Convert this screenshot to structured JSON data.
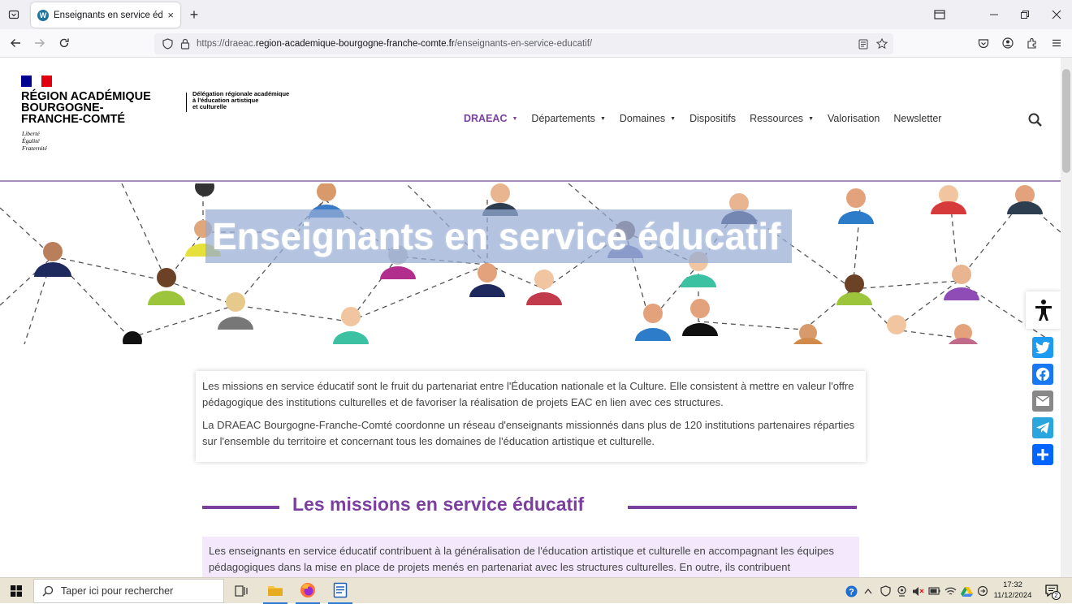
{
  "browser": {
    "tab_title": "Enseignants en service éducatif",
    "tab_close": "×",
    "new_tab": "+",
    "url_prefix": "https://draeac.",
    "url_domain": "region-academique-bourgogne-franche-comte.fr",
    "url_path": "/enseignants-en-service-educatif/"
  },
  "site": {
    "org_line1": "RÉGION ACADÉMIQUE",
    "org_line2": "BOURGOGNE-",
    "org_line3": "FRANCHE-COMTÉ",
    "motto1": "Liberté",
    "motto2": "Égalité",
    "motto3": "Fraternité",
    "dept_line1": "Délégation régionale académique",
    "dept_line2": "à l'éducation artistique",
    "dept_line3": "et culturelle"
  },
  "menu": {
    "items": [
      {
        "label": "DRAEAC",
        "caret": "▼"
      },
      {
        "label": "Départements",
        "caret": "▼"
      },
      {
        "label": "Domaines",
        "caret": "▼"
      },
      {
        "label": "Dispositifs",
        "caret": ""
      },
      {
        "label": "Ressources",
        "caret": "▼"
      },
      {
        "label": "Valorisation",
        "caret": ""
      },
      {
        "label": "Newsletter",
        "caret": ""
      }
    ]
  },
  "hero": {
    "title": "Enseignants en service éducatif"
  },
  "intro": {
    "p1": "Les missions en service éducatif sont le fruit du partenariat entre l'Éducation nationale et la Culture. Elle consistent à mettre en valeur l'offre pédagogique des institutions culturelles et de favoriser la réalisation de projets EAC en lien avec ces structures.",
    "p2": "La DRAEAC Bourgogne-Franche-Comté coordonne un réseau d'enseignants missionnés dans plus de 120 institutions partenaires réparties sur l'ensemble du territoire et concernant tous les domaines de l'éducation artistique et culturelle."
  },
  "section": {
    "title": "Les missions en service éducatif",
    "body": "Les enseignants en service éducatif contribuent à la généralisation de l'éducation artistique et culturelle en accompagnant les équipes pédagogiques dans la mise en place de projets menés en partenariat avec les structures culturelles. En outre, ils contribuent"
  },
  "colors": {
    "accent": "#7b3fa0",
    "twitter": "#1d9bf0",
    "facebook": "#1877f2",
    "email": "#888888",
    "telegram": "#2aa5dd",
    "addtoany": "#0166ff"
  },
  "share": {
    "icons": [
      "accessibility-icon",
      "twitter-icon",
      "facebook-icon",
      "email-icon",
      "telegram-icon",
      "share-icon"
    ]
  },
  "taskbar": {
    "search_placeholder": "Taper ici pour rechercher",
    "time": "17:32",
    "date": "11/12/2024",
    "notif_count": "2"
  }
}
